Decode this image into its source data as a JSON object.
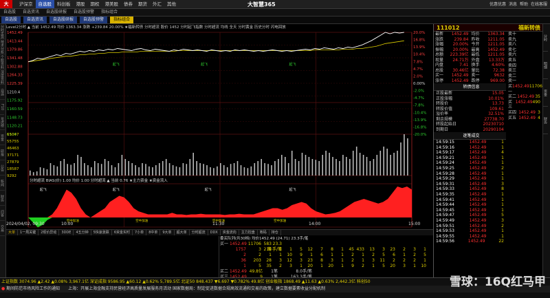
{
  "titlebar": {
    "menu": [
      "沪深京",
      "自选股",
      "科创板",
      "港股",
      "期权",
      "港美股",
      "债券",
      "期货",
      "外汇",
      "其他"
    ],
    "active": 1,
    "title": "大智慧365",
    "right": [
      "优惠优惠",
      "消息",
      "帮助",
      "在线客服"
    ]
  },
  "toolbar": [
    "自选股",
    "自选资讯",
    "自选股研报",
    "自选股预警",
    "指标组合"
  ],
  "tabs2": [
    {
      "label": "自选股",
      "hl": false
    },
    {
      "label": "自选资讯",
      "hl": false
    },
    {
      "label": "自选股研报",
      "hl": false
    },
    {
      "label": "自选股预警",
      "hl": false
    },
    {
      "label": "指标组合",
      "hl": true
    }
  ],
  "sidebar": [
    "分时走势",
    "技术分析",
    "个股资料",
    "深度资料",
    "自选",
    "F10",
    "龙虎榜",
    "资金",
    "研报",
    "公告",
    "新闻",
    "财务",
    "问答",
    "交易"
  ],
  "chart": {
    "info": "Level2分时  ▲ 当前 1452.49  均价 1363.34  涨跌 +239.84  20.00%  ★福新转债  分时超流  股价 1452  分时起飞指数  分时超流  均线  全天  分时黄金  历史分时  闪电回放",
    "info2": "分时超流  1452.49  均价 1363.34",
    "price_labels": [
      "1452",
      "1413",
      "1374",
      "1335",
      "1296",
      "1257",
      "1218",
      "1208",
      "1175",
      "1164",
      "1142",
      "1131",
      "1120"
    ],
    "left_scale": [
      1452.49,
      1413.44,
      1379.86,
      1341.48,
      1302.88,
      1264.33,
      1225.39,
      1210.4,
      1175.92,
      1160.59,
      1148.73,
      1120.21,
      1100.0
    ],
    "pct_labels": [
      "20.0%",
      "16.8%",
      "13.9%",
      "10.4%",
      "7.8%",
      "4.7%",
      "2.0%",
      "0.00%",
      "-2.0%",
      "-4.7%",
      "-7.8%",
      "-10.4%",
      "-13.9%",
      "-16.8%",
      "-20.0%"
    ],
    "volume_labels": [
      "65047",
      "55755",
      "46463",
      "37171",
      "27879",
      "18587",
      "9292"
    ],
    "volume_bars": [
      0.12,
      0.08,
      0.1,
      0.2,
      0.18,
      0.15,
      0.3,
      0.25,
      0.22,
      0.35,
      0.4,
      0.28,
      0.26,
      0.3,
      0.5,
      0.45,
      0.3,
      0.25,
      0.2,
      0.35,
      0.3,
      0.28,
      0.4,
      0.35,
      0.25,
      0.2,
      0.3,
      0.5,
      0.4,
      0.35,
      0.3,
      0.25,
      0.2,
      0.3,
      0.28,
      0.22,
      0.2,
      0.25,
      0.3,
      0.35,
      0.4,
      0.3,
      0.25,
      0.22,
      0.2,
      0.3,
      0.28,
      0.4,
      0.55,
      0.35,
      0.3,
      0.28,
      0.25,
      0.2,
      0.18,
      0.22,
      0.3,
      0.25,
      0.2,
      0.28,
      0.3,
      0.35,
      0.25,
      0.2,
      0.18,
      0.22,
      0.3,
      0.35,
      0.4,
      0.3,
      0.28,
      0.25,
      0.35,
      0.4,
      0.5,
      0.45,
      0.3,
      0.6,
      0.4,
      0.35,
      0.55,
      0.5,
      0.45,
      0.4,
      0.38,
      0.35,
      0.5,
      0.6,
      0.55,
      0.45,
      0.4,
      0.35,
      0.5,
      0.45,
      0.4,
      0.6,
      0.7,
      0.55,
      0.5,
      0.45,
      0.35,
      0.4,
      0.5,
      0.6,
      0.7,
      0.65,
      0.5,
      0.55,
      0.6,
      0.8,
      1.0,
      0.9
    ],
    "price_line": [
      0.58,
      0.6,
      0.63,
      0.62,
      0.64,
      0.66,
      0.68,
      0.67,
      0.7,
      0.69,
      0.71,
      0.73,
      0.72,
      0.74,
      0.73,
      0.75,
      0.74,
      0.76,
      0.75,
      0.77,
      0.76,
      0.75,
      0.74,
      0.76,
      0.77,
      0.75,
      0.74,
      0.76,
      0.75,
      0.74,
      0.73,
      0.75,
      0.74,
      0.76,
      0.75,
      0.74,
      0.75,
      0.74,
      0.73,
      0.75,
      0.74,
      0.73,
      0.74,
      0.73,
      0.75,
      0.74,
      0.75,
      0.74,
      0.73,
      0.74,
      0.73,
      0.74,
      0.75,
      0.74,
      0.73,
      0.74,
      0.73,
      0.74,
      0.75,
      0.76,
      0.75,
      0.77,
      0.76,
      0.78,
      0.77,
      0.76,
      0.78,
      0.77,
      0.79,
      0.78,
      0.8,
      0.82,
      0.85,
      0.88,
      0.92,
      0.96,
      1.0,
      0.98,
      1.0,
      0.99,
      1.0
    ],
    "avg_line": [
      0.58,
      0.59,
      0.6,
      0.61,
      0.62,
      0.63,
      0.64,
      0.65,
      0.66,
      0.66,
      0.67,
      0.68,
      0.68,
      0.69,
      0.69,
      0.7,
      0.7,
      0.71,
      0.71,
      0.71,
      0.72,
      0.72,
      0.72,
      0.72,
      0.73,
      0.73,
      0.73,
      0.73,
      0.73,
      0.73,
      0.73,
      0.73,
      0.74,
      0.74,
      0.74,
      0.74,
      0.74,
      0.74,
      0.74,
      0.74,
      0.74,
      0.74,
      0.74,
      0.74,
      0.74,
      0.74,
      0.74,
      0.74,
      0.74,
      0.74,
      0.74,
      0.74,
      0.74,
      0.74,
      0.74,
      0.74,
      0.74,
      0.74,
      0.74,
      0.74,
      0.74,
      0.75,
      0.75,
      0.75,
      0.75,
      0.75,
      0.75,
      0.76,
      0.76,
      0.76,
      0.77,
      0.77,
      0.78,
      0.79,
      0.8,
      0.82,
      0.84,
      0.85,
      0.86,
      0.87,
      0.88
    ],
    "ind_area": [
      0.0,
      -0.2,
      -0.4,
      -0.3,
      -0.1,
      0.1,
      0.3,
      0.6,
      0.9,
      0.8,
      0.6,
      0.3,
      0.1,
      0.0,
      0.1,
      0.2,
      0.3,
      0.5,
      0.6,
      0.7,
      0.65,
      0.5,
      0.3,
      0.2,
      0.15,
      0.1,
      0.1,
      0.1,
      0.1,
      0.1,
      0.15,
      0.1,
      0.1,
      0.08,
      0.1,
      0.1,
      0.12,
      0.1,
      0.1,
      0.1,
      0.1,
      0.08,
      0.1,
      0.1,
      0.12,
      0.1,
      0.1,
      0.1,
      0.15,
      0.2,
      0.25,
      0.3,
      0.3,
      0.25,
      0.3,
      0.4,
      0.45,
      0.5,
      0.45,
      0.3,
      0.2,
      0.15,
      0.1,
      0.12,
      0.15,
      0.2,
      0.3,
      0.4,
      0.5,
      0.55,
      0.6,
      0.55,
      0.5,
      0.45,
      0.5,
      0.6,
      0.8,
      1.0,
      0.95,
      1.0,
      0.9
    ],
    "time_labels": [
      "2024/04/02, 09:30",
      "10:00",
      "11:30",
      "14:00",
      "15:00"
    ],
    "ind_labels": [
      "起飞",
      "起飞",
      "起飞",
      "起飞"
    ],
    "ind_title": "分时超流  BIAS(价) 1.00  均价 1.00  分时超流  ▲ 当前 0.76  ★主力资金  ★资金流入",
    "rk_label": "空中加油"
  },
  "bottomtabs": [
    {
      "label": "大单",
      "hl": true
    },
    {
      "label": "1一周关键",
      "hl": false
    },
    {
      "label": "2现价异动",
      "hl": false
    },
    {
      "label": "3DDE",
      "hl": false
    },
    {
      "label": "4五分钟",
      "hl": false
    },
    {
      "label": "5快速涨跌",
      "hl": false
    },
    {
      "label": "6资金实时",
      "hl": false
    },
    {
      "label": "7小单",
      "hl": false
    },
    {
      "label": "8中单",
      "hl": false
    },
    {
      "label": "9大单",
      "hl": false
    },
    {
      "label": "超大单",
      "hl": false
    },
    {
      "label": "分时超流",
      "hl": false
    },
    {
      "label": "DDX",
      "hl": false
    },
    {
      "label": "资金流向",
      "hl": false
    },
    {
      "label": "主力控盘",
      "hl": false
    },
    {
      "label": "筹码",
      "hl": false
    },
    {
      "label": "持仓",
      "hl": false
    }
  ],
  "orderbook": {
    "head": "委买队列(共30档)  均价1452.49  (24.71)  23.3手/笔",
    "rows": [
      {
        "label": "买一",
        "price": "1452.49",
        "vol": "11706",
        "cols": [
          "583笔",
          "23.3手/笔"
        ]
      },
      {
        "label": "",
        "price": "1757",
        "vol": "3",
        "cols": [
          "219",
          "2",
          "1",
          "5",
          "12",
          "7",
          "8",
          "1",
          "45",
          "433",
          "13",
          "3",
          "23",
          "2",
          "3",
          "1"
        ]
      },
      {
        "label": "",
        "price": "2",
        "vol": "2",
        "cols": [
          "1",
          "1",
          "10",
          "9",
          "1",
          "6",
          "1",
          "1",
          "2",
          "1",
          "2",
          "5",
          "6",
          "1",
          "2",
          "5"
        ]
      },
      {
        "label": "",
        "price": "36",
        "vol": "203",
        "cols": [
          "28",
          "3",
          "12",
          "3",
          "23",
          "8",
          "3",
          "1",
          "2",
          "1",
          "3",
          "11",
          "2",
          "2",
          "2",
          "1"
        ]
      },
      {
        "label": "",
        "price": "1",
        "vol": "5",
        "cols": [
          "35",
          "2",
          "3",
          "1",
          "20",
          "1",
          "20",
          "1",
          "9",
          "2",
          "1",
          "5",
          "20",
          "3",
          "1",
          "10"
        ]
      }
    ],
    "sell": [
      {
        "label": "买二",
        "price": "1452.49",
        "vol": "49.8亿",
        "extra": "1笔",
        "extra2": "8.0手/笔"
      },
      {
        "label": "买三",
        "price": "1452.49",
        "vol": "9",
        "extra": "1笔",
        "extra2": "163.3手/笔"
      },
      {
        "label": "买四",
        "price": "1452.49",
        "vol": "34",
        "extra": "1笔",
        "extra2": "163.5手/笔"
      }
    ]
  },
  "quote": {
    "code": "111012",
    "name": "福新转债",
    "rows": [
      {
        "k": "最新",
        "v": "1452.49",
        "k2": "均价",
        "v2": "1363.34"
      },
      {
        "k": "涨跌",
        "v": "239.84",
        "k2": "昨收",
        "v2": "1211.05"
      },
      {
        "k": "涨幅",
        "v": "20.00%",
        "k2": "今开",
        "v2": "1211.05"
      },
      {
        "k": "振幅",
        "v": "20.00%",
        "k2": "最高",
        "v2": "1452.49"
      },
      {
        "k": "总额",
        "v": "223.39亿",
        "k2": "最低",
        "v2": "1211.05"
      },
      {
        "k": "现量",
        "v": "24.71万",
        "k2": "外盘",
        "v2": "13.33万"
      },
      {
        "k": "内盘",
        "v": "7.41",
        "k2": "换手",
        "v2": "4.60%"
      },
      {
        "k": "总股",
        "v": "30.46亿",
        "k2": "量比",
        "v2": "72.38"
      },
      {
        "k": "买一",
        "v": "1452.49",
        "k2": "卖一",
        "v2": "9632"
      },
      {
        "k": "涨停",
        "v": "1452.49",
        "k2": "跌停",
        "v2": "969.00"
      }
    ],
    "bond_head": "转债信息",
    "bond": [
      {
        "k": "正股最新",
        "v": "15.05"
      },
      {
        "k": "正股涨幅",
        "v": "10.01%"
      },
      {
        "k": "转股价",
        "v": "13.73"
      },
      {
        "k": "转股价值",
        "v": "109.61"
      },
      {
        "k": "溢价率",
        "v": "32.51%"
      },
      {
        "k": "剩余规模",
        "v": "27738.70"
      },
      {
        "k": "转股起始日",
        "v": "20230710"
      },
      {
        "k": "到期日",
        "v": "20290104"
      }
    ],
    "ladder_head": "卖十~卖一",
    "ladder": [
      {
        "k": "卖十",
        "v": "",
        "n": ""
      },
      {
        "k": "卖九",
        "v": "",
        "n": ""
      },
      {
        "k": "卖八",
        "v": "",
        "n": ""
      },
      {
        "k": "卖七",
        "v": "",
        "n": ""
      },
      {
        "k": "卖六",
        "v": "",
        "n": ""
      },
      {
        "k": "卖五",
        "v": "",
        "n": ""
      },
      {
        "k": "卖四",
        "v": "",
        "n": ""
      },
      {
        "k": "卖三",
        "v": "",
        "n": ""
      },
      {
        "k": "卖二",
        "v": "",
        "n": ""
      },
      {
        "k": "卖一",
        "v": "",
        "n": ""
      },
      {
        "k": "买一",
        "v": "1452.49",
        "n": "11706"
      },
      {
        "k": "买二",
        "v": "1452.49",
        "n": "35"
      },
      {
        "k": "买三",
        "v": "1452.49",
        "n": "490"
      },
      {
        "k": "买四",
        "v": "1452.49",
        "n": "3"
      },
      {
        "k": "买五",
        "v": "1452.49",
        "n": "4"
      }
    ],
    "ticks_head": "逐笔成交",
    "ticks": [
      {
        "t": "14:59:15",
        "p": "1452.49",
        "n": "1"
      },
      {
        "t": "14:59:16",
        "p": "1452.49",
        "n": "1"
      },
      {
        "t": "14:59:17",
        "p": "1452.49",
        "n": "4"
      },
      {
        "t": "14:59:21",
        "p": "1452.49",
        "n": "1"
      },
      {
        "t": "14:59:24",
        "p": "1452.49",
        "n": "1"
      },
      {
        "t": "14:59:25",
        "p": "1452.49",
        "n": "2"
      },
      {
        "t": "14:59:28",
        "p": "1452.49",
        "n": "1"
      },
      {
        "t": "14:59:29",
        "p": "1452.49",
        "n": "1"
      },
      {
        "t": "14:59:31",
        "p": "1452.49",
        "n": "3"
      },
      {
        "t": "14:59:33",
        "p": "1452.49",
        "n": "8"
      },
      {
        "t": "14:59:35",
        "p": "1452.49",
        "n": "1"
      },
      {
        "t": "14:59:41",
        "p": "1452.49",
        "n": "1"
      },
      {
        "t": "14:59:44",
        "p": "1452.49",
        "n": "1"
      },
      {
        "t": "14:59:45",
        "p": "1452.49",
        "n": "1"
      },
      {
        "t": "14:59:47",
        "p": "1452.49",
        "n": "5"
      },
      {
        "t": "14:59:49",
        "p": "1452.49",
        "n": "3"
      },
      {
        "t": "14:59:51",
        "p": "1452.49",
        "n": "2"
      },
      {
        "t": "14:59:53",
        "p": "1452.49",
        "n": "1"
      },
      {
        "t": "14:59:55",
        "p": "1452.49",
        "n": "1"
      },
      {
        "t": "14:59:56",
        "p": "1452.49",
        "n": "22"
      },
      {
        "t": "14:59:58",
        "p": "1452.49",
        "n": "52"
      },
      {
        "t": "15:00:00",
        "p": "1452.49",
        "n": "2"
      }
    ]
  },
  "statusbar": {
    "index": "上证指数 3074.96 ▲2.42 ▲0.08%  3,967.1亿  深证成指 9586.95 ▲60.12 ▲0.62%  5,789.5亿  北证50 848.437 ▼6.697 ▼0.782%  49.8亿  创业板指 1868.49 ▲11.63 ▲0.63%  2,442.3亿  科创50",
    "news": "上海：开展上海金融支持民营经济高质量发展服务月活动   国家数据局：制定促进数据合规高效流通和交易的政策，建立数据要素收益分配机制",
    "news_left": "期间防范市场风险工作的通知"
  },
  "watermark": "雪球：16Q红马甲",
  "colors": {
    "up": "#ff3030",
    "down": "#30d030",
    "accent": "#2a4fa8",
    "highlight": "#d9b300"
  }
}
